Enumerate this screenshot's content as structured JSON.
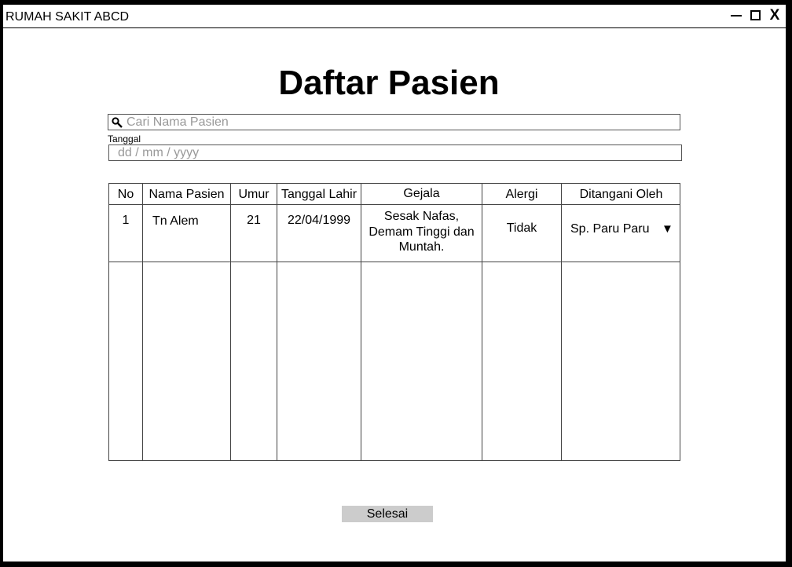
{
  "window": {
    "title": "RUMAH SAKIT ABCD",
    "controls": {
      "minimize": "minimize-icon",
      "maximize": "maximize-icon",
      "close": "X"
    }
  },
  "page": {
    "title": "Daftar Pasien"
  },
  "search": {
    "placeholder": "Cari Nama Pasien",
    "icon": "search-icon"
  },
  "date_field": {
    "label": "Tanggal",
    "placeholder": "dd / mm / yyyy"
  },
  "table": {
    "headers": [
      "No",
      "Nama Pasien",
      "Umur",
      "Tanggal Lahir",
      "Gejala",
      "Alergi",
      "Ditangani Oleh"
    ],
    "rows": [
      {
        "no": "1",
        "nama": "Tn Alem",
        "umur": "21",
        "tanggal_lahir": "22/04/1999",
        "gejala_lines": [
          "Sesak Nafas,",
          "Demam Tinggi dan",
          "Muntah."
        ],
        "alergi": "Tidak",
        "ditangani_oleh": "Sp. Paru Paru",
        "dropdown_icon": "▼"
      }
    ]
  },
  "footer": {
    "done_label": "Selesai"
  }
}
